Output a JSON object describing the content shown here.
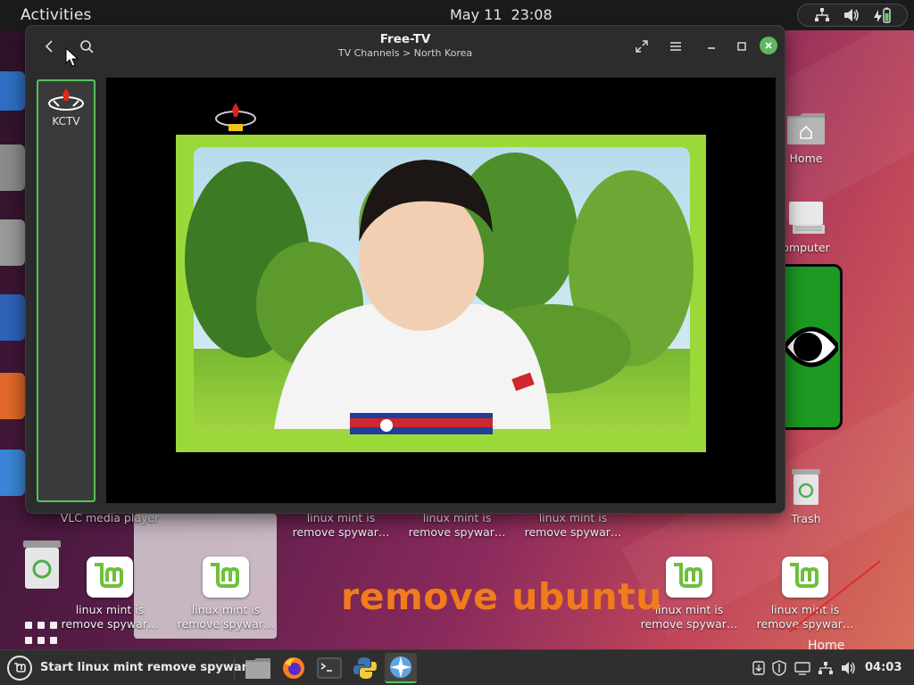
{
  "topbar": {
    "activities": "Activities",
    "date": "May 11",
    "time": "23:08",
    "tray_icons": [
      "network-icon",
      "volume-icon",
      "battery-icon"
    ]
  },
  "window": {
    "title": "Free-TV",
    "subtitle": "TV Channels > North Korea",
    "controls": [
      "back-icon",
      "search-icon",
      "fullscreen-icon",
      "menu-icon",
      "minimize-icon",
      "maximize-icon",
      "close-icon"
    ]
  },
  "channels": [
    {
      "name": "KCTV",
      "selected": true
    }
  ],
  "desktop": {
    "icons": [
      {
        "label": "Home",
        "kind": "folder"
      },
      {
        "label": "omputer",
        "kind": "computer"
      },
      {
        "label": "Trash",
        "kind": "trash"
      },
      {
        "label": "VLC media player",
        "kind": "app"
      },
      {
        "label": "linux mint is remove spywar…",
        "kind": "text"
      },
      {
        "label": "linux mint is remove spywar…",
        "kind": "text"
      },
      {
        "label": "linux mint is remove spywar…",
        "kind": "text"
      },
      {
        "label": "linux mint is remove spywar…",
        "kind": "mint"
      },
      {
        "label": "linux mint is remove spywar…",
        "kind": "mint"
      },
      {
        "label": "linux mint is remove spywar…",
        "kind": "mint"
      },
      {
        "label": "linux mint is remove spywar…",
        "kind": "mint"
      },
      {
        "label": "Home",
        "kind": "folder-cut"
      }
    ],
    "banner": "remove ubuntu"
  },
  "panel": {
    "menu_label": "Start linux mint remove spyware",
    "launchers": [
      "files-icon",
      "firefox-icon",
      "terminal-icon",
      "python-icon",
      "free-tv-icon"
    ],
    "tray": [
      "update-icon",
      "shield-icon",
      "display-icon",
      "network-icon",
      "volume-icon"
    ],
    "clock": "04:03"
  },
  "colors": {
    "accent": "#57c25b",
    "topbar": "#1b1b1b",
    "panel": "#2f2f2f",
    "banner": "#f07d1a"
  }
}
